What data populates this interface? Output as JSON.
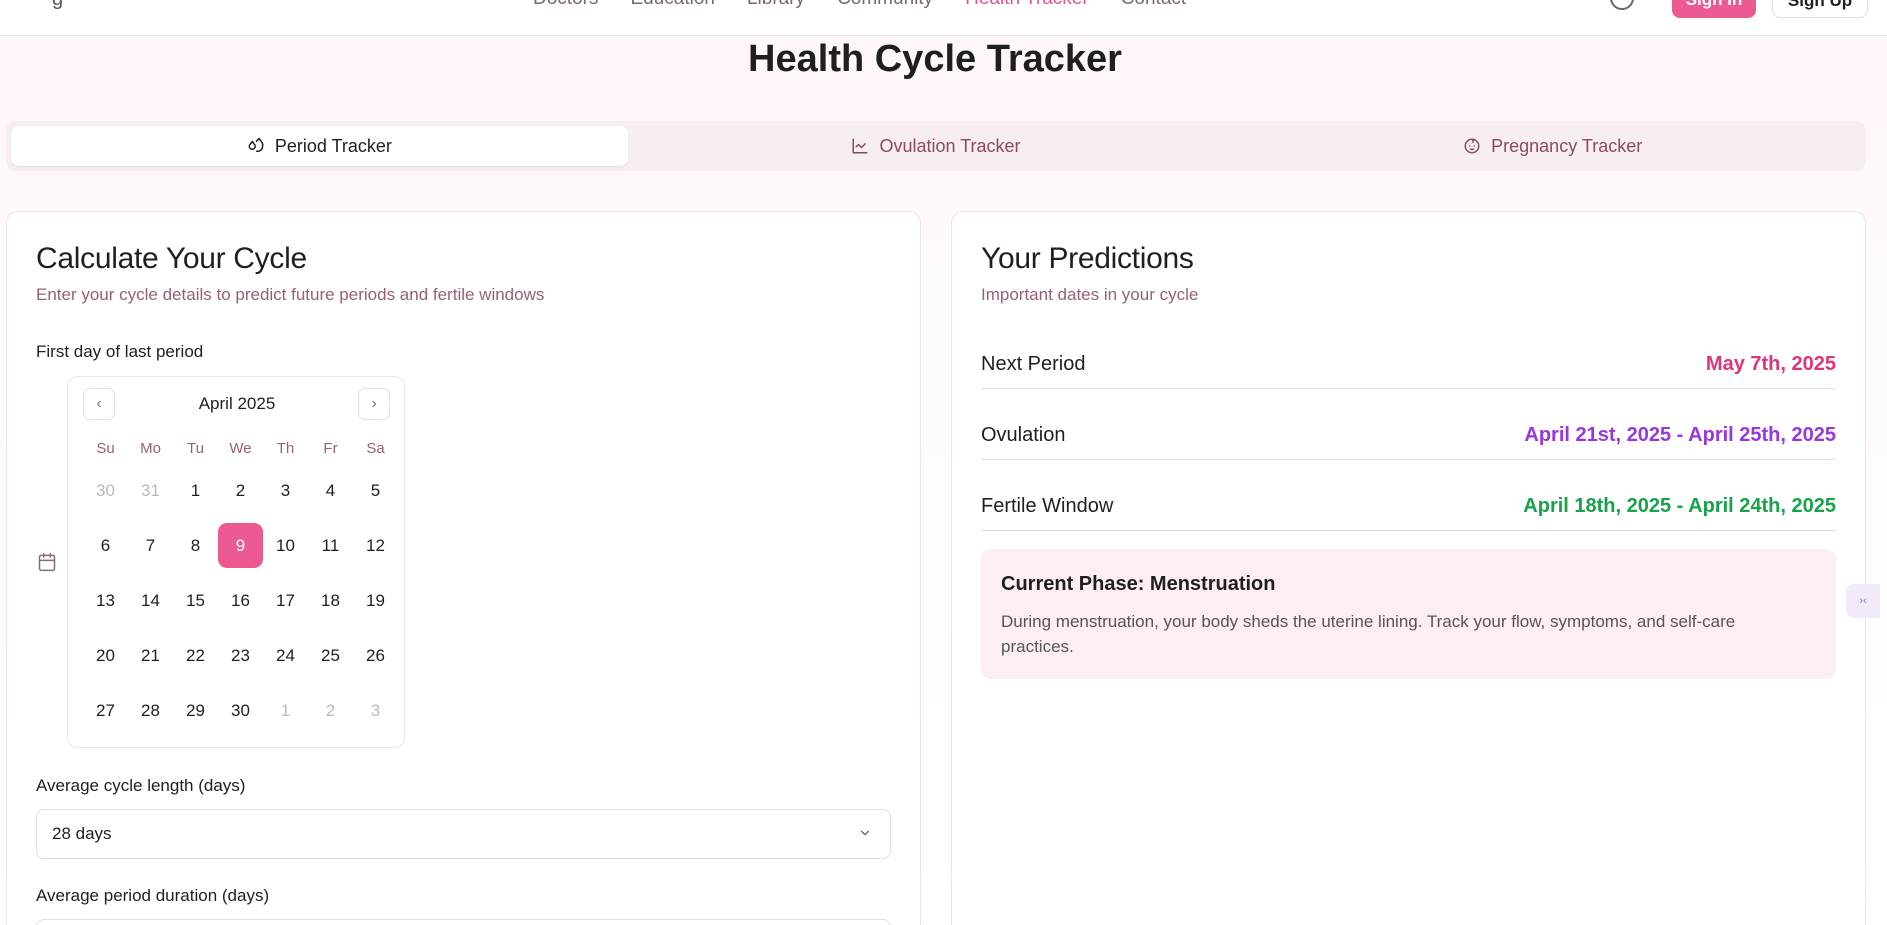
{
  "nav": {
    "logo_fragment": "g",
    "links": [
      "Doctors",
      "Education",
      "Library",
      "Community",
      "Health Tracker",
      "Contact"
    ],
    "active_link": "Health Tracker",
    "sign_in": "Sign In",
    "sign_up": "Sign Up"
  },
  "page": {
    "title": "Health Cycle Tracker"
  },
  "tabs": [
    {
      "label": "Period Tracker",
      "icon": "droplet-icon",
      "active": true
    },
    {
      "label": "Ovulation Tracker",
      "icon": "line-chart-icon",
      "active": false
    },
    {
      "label": "Pregnancy Tracker",
      "icon": "baby-icon",
      "active": false
    }
  ],
  "calculate": {
    "title": "Calculate Your Cycle",
    "subtitle": "Enter your cycle details to predict future periods and fertile windows",
    "first_day_label": "First day of last period",
    "calendar": {
      "month_label": "April 2025",
      "weekdays": [
        "Su",
        "Mo",
        "Tu",
        "We",
        "Th",
        "Fr",
        "Sa"
      ],
      "weeks": [
        [
          "30",
          "31",
          "1",
          "2",
          "3",
          "4",
          "5"
        ],
        [
          "6",
          "7",
          "8",
          "9",
          "10",
          "11",
          "12"
        ],
        [
          "13",
          "14",
          "15",
          "16",
          "17",
          "18",
          "19"
        ],
        [
          "20",
          "21",
          "22",
          "23",
          "24",
          "25",
          "26"
        ],
        [
          "27",
          "28",
          "29",
          "30",
          "1",
          "2",
          "3"
        ]
      ],
      "selected_day": "9"
    },
    "cycle_length_label": "Average cycle length (days)",
    "cycle_length_value": "28 days",
    "period_duration_label": "Average period duration (days)",
    "period_duration_value": ""
  },
  "predictions": {
    "title": "Your Predictions",
    "subtitle": "Important dates in your cycle",
    "rows": [
      {
        "label": "Next Period",
        "value": "May 7th, 2025",
        "color": "#e0337a"
      },
      {
        "label": "Ovulation",
        "value": "April 21st, 2025 - April 25th, 2025",
        "color": "#9a36e0"
      },
      {
        "label": "Fertile Window",
        "value": "April 18th, 2025 - April 24th, 2025",
        "color": "#16a34a"
      }
    ],
    "phase_title": "Current Phase: Menstruation",
    "phase_text": "During menstruation, your body sheds the uterine lining. Track your flow, symptoms, and self-care practices."
  },
  "colors": {
    "accent": "#ec5a93",
    "muted_text": "#9a5f76"
  }
}
